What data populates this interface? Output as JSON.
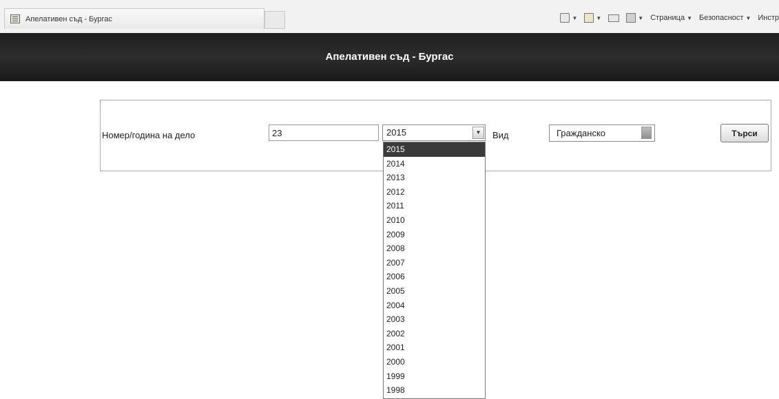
{
  "browser": {
    "tab_title": "Апелативен съд - Бургас",
    "tools": {
      "page_menu": "Страница",
      "security_menu": "Безопасност",
      "tools_menu": "Инстр"
    }
  },
  "header": {
    "title": "Апелативен съд - Бургас"
  },
  "search_form": {
    "case_label": "Номер/година на дело",
    "case_number": "23",
    "year_selected": "2015",
    "type_label": "Вид",
    "type_selected": "Гражданско",
    "search_button": "Търси"
  },
  "year_options": [
    "2015",
    "2014",
    "2013",
    "2012",
    "2011",
    "2010",
    "2009",
    "2008",
    "2007",
    "2006",
    "2005",
    "2004",
    "2003",
    "2002",
    "2001",
    "2000",
    "1999",
    "1998"
  ],
  "selected_year_index": 0
}
